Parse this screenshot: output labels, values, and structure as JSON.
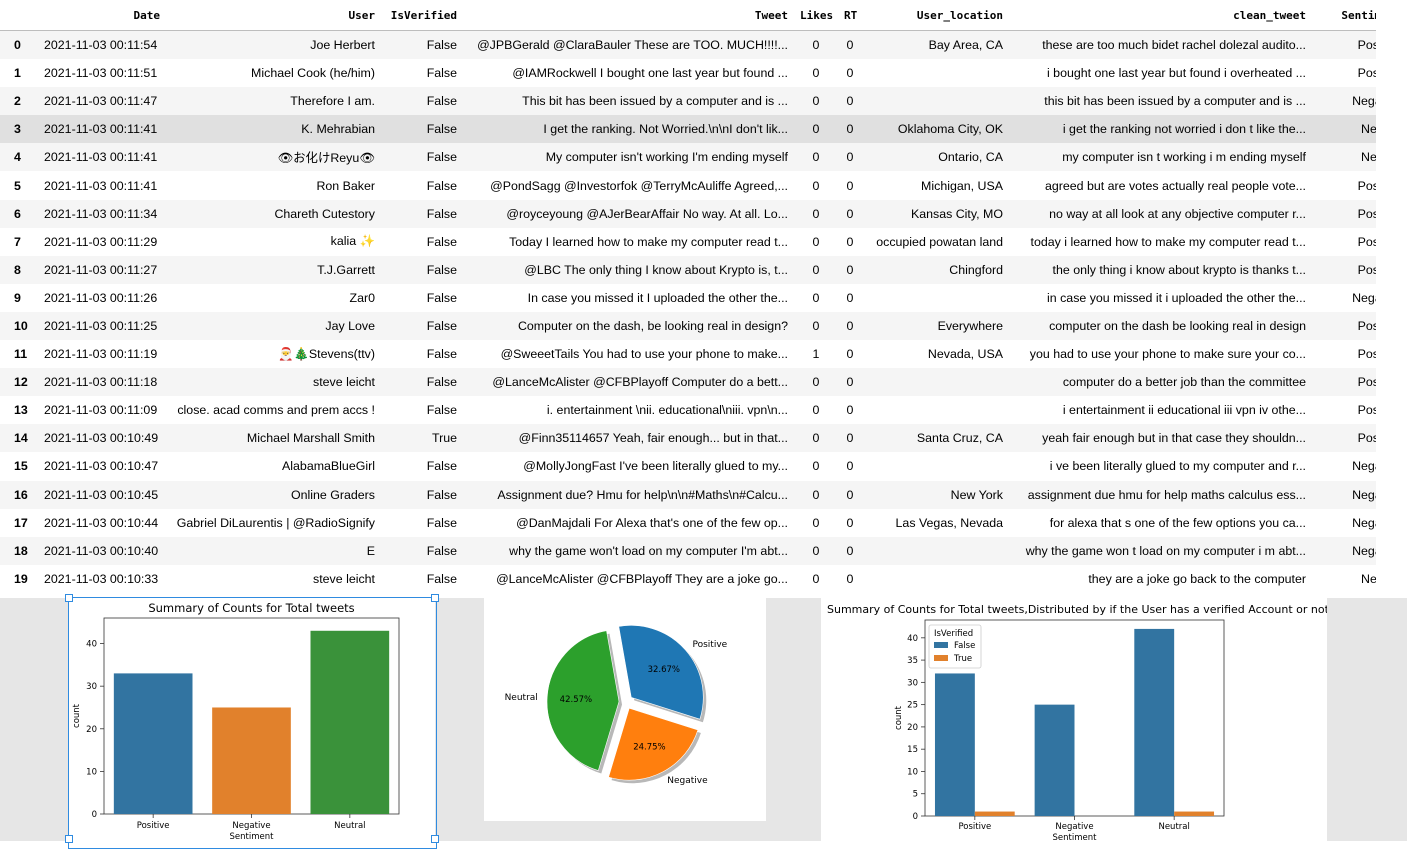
{
  "table": {
    "columns": [
      "",
      "Date",
      "User",
      "IsVerified",
      "Tweet",
      "Likes",
      "RT",
      "User_location",
      "clean_tweet",
      "Sentiment"
    ],
    "highlighted_row": 3,
    "rows": [
      [
        "0",
        "2021-11-03 00:11:54",
        "Joe Herbert",
        "False",
        "@JPBGerald @ClaraBauler These are TOO. MUCH!!!!...",
        "0",
        "0",
        "Bay Area, CA",
        "these are too much bidet rachel dolezal audito...",
        "Positive"
      ],
      [
        "1",
        "2021-11-03 00:11:51",
        "Michael Cook (he/him)",
        "False",
        "@IAMRockwell I bought one last year but found ...",
        "0",
        "0",
        "",
        "i bought one last year but found i overheated ...",
        "Positive"
      ],
      [
        "2",
        "2021-11-03 00:11:47",
        "Therefore I am.",
        "False",
        "This bit has been issued by a computer and is ...",
        "0",
        "0",
        "",
        "this bit has been issued by a computer and is ...",
        "Negative"
      ],
      [
        "3",
        "2021-11-03 00:11:41",
        "K. Mehrabian",
        "False",
        "I get the ranking. Not Worried.\\n\\nI don't lik...",
        "0",
        "0",
        "Oklahoma City, OK",
        "i get the ranking not worried i don t like the...",
        "Neutral"
      ],
      [
        "4",
        "2021-11-03 00:11:41",
        "👁お化けReyu👁",
        "False",
        "My computer isn't working I'm ending myself",
        "0",
        "0",
        "Ontario, CA",
        "my computer isn t working i m ending myself",
        "Neutral"
      ],
      [
        "5",
        "2021-11-03 00:11:41",
        "Ron Baker",
        "False",
        "@PondSagg @Investorfok @TerryMcAuliffe Agreed,...",
        "0",
        "0",
        "Michigan, USA",
        "agreed but are votes actually real people vote...",
        "Positive"
      ],
      [
        "6",
        "2021-11-03 00:11:34",
        "Chareth Cutestory",
        "False",
        "@royceyoung @AJerBearAffair No way. At all. Lo...",
        "0",
        "0",
        "Kansas City, MO",
        "no way at all look at any objective computer r...",
        "Positive"
      ],
      [
        "7",
        "2021-11-03 00:11:29",
        "kalia ✨",
        "False",
        "Today I learned how to make my computer read t...",
        "0",
        "0",
        "occupied powatan land",
        "today i learned how to make my computer read t...",
        "Positive"
      ],
      [
        "8",
        "2021-11-03 00:11:27",
        "T.J.Garrett",
        "False",
        "@LBC The only thing I know about Krypto is, t...",
        "0",
        "0",
        "Chingford",
        "the only thing i know about krypto is thanks t...",
        "Positive"
      ],
      [
        "9",
        "2021-11-03 00:11:26",
        "Zar0",
        "False",
        "In case you missed it I uploaded the other the...",
        "0",
        "0",
        "",
        "in case you missed it i uploaded the other the...",
        "Negative"
      ],
      [
        "10",
        "2021-11-03 00:11:25",
        "Jay Love",
        "False",
        "Computer on the dash, be looking real in design?",
        "0",
        "0",
        "Everywhere",
        "computer on the dash be looking real in design",
        "Positive"
      ],
      [
        "11",
        "2021-11-03 00:11:19",
        "🎅🎄Stevens(ttv)",
        "False",
        "@SweeetTails You had to use your phone to make...",
        "1",
        "0",
        "Nevada, USA",
        "you had to use your phone to make sure your co...",
        "Positive"
      ],
      [
        "12",
        "2021-11-03 00:11:18",
        "steve leicht",
        "False",
        "@LanceMcAlister @CFBPlayoff Computer do a bett...",
        "0",
        "0",
        "",
        "computer do a better job than the committee",
        "Positive"
      ],
      [
        "13",
        "2021-11-03 00:11:09",
        "close. acad comms and prem accs !",
        "False",
        "i. entertainment \\nii. educational\\niii. vpn\\n...",
        "0",
        "0",
        "",
        "i entertainment ii educational iii vpn iv othe...",
        "Positive"
      ],
      [
        "14",
        "2021-11-03 00:10:49",
        "Michael Marshall Smith",
        "True",
        "@Finn35114657 Yeah, fair enough... but in that...",
        "0",
        "0",
        "Santa Cruz, CA",
        "yeah fair enough but in that case they shouldn...",
        "Positive"
      ],
      [
        "15",
        "2021-11-03 00:10:47",
        "AlabamaBlueGirl",
        "False",
        "@MollyJongFast I've been literally glued to my...",
        "0",
        "0",
        "",
        "i ve been literally glued to my computer and r...",
        "Negative"
      ],
      [
        "16",
        "2021-11-03 00:10:45",
        "Online Graders",
        "False",
        "Assignment due? Hmu for help\\n\\n#Maths\\n#Calcu...",
        "0",
        "0",
        "New York",
        "assignment due hmu for help maths calculus ess...",
        "Negative"
      ],
      [
        "17",
        "2021-11-03 00:10:44",
        "Gabriel DiLaurentis | @RadioSignify",
        "False",
        "@DanMajdali For Alexa that's one of the few op...",
        "0",
        "0",
        "Las Vegas, Nevada",
        "for alexa that s one of the few options you ca...",
        "Negative"
      ],
      [
        "18",
        "2021-11-03 00:10:40",
        "E",
        "False",
        "why the game won't load on my computer I'm abt...",
        "0",
        "0",
        "",
        "why the game won t load on my computer i m abt...",
        "Negative"
      ],
      [
        "19",
        "2021-11-03 00:10:33",
        "steve leicht",
        "False",
        "@LanceMcAlister @CFBPlayoff They are a joke go...",
        "0",
        "0",
        "",
        "they are a joke go back to the computer",
        "Neutral"
      ]
    ]
  },
  "chart_data": [
    {
      "type": "bar",
      "title": "Summary of Counts for Total tweets",
      "xlabel": "Sentiment",
      "ylabel": "count",
      "categories": [
        "Positive",
        "Negative",
        "Neutral"
      ],
      "values": [
        33,
        25,
        43
      ],
      "colors": [
        "#3274a1",
        "#e1812c",
        "#3a923a"
      ],
      "ylim": [
        0,
        46
      ],
      "yticks": [
        0,
        10,
        20,
        30,
        40
      ]
    },
    {
      "type": "pie",
      "labels": [
        "Positive",
        "Negative",
        "Neutral"
      ],
      "values": [
        32.67,
        24.75,
        42.57
      ],
      "pct_labels": [
        "32.67%",
        "24.75%",
        "42.57%"
      ],
      "colors": [
        "#1f77b4",
        "#ff7f0e",
        "#2ca02c"
      ]
    },
    {
      "type": "bar",
      "title": "Summary of Counts for Total tweets,Distributed by if the User has a verified Account or not",
      "xlabel": "Sentiment",
      "ylabel": "count",
      "categories": [
        "Positive",
        "Negative",
        "Neutral"
      ],
      "series": [
        {
          "name": "False",
          "values": [
            32,
            25,
            42
          ],
          "color": "#3274a1"
        },
        {
          "name": "True",
          "values": [
            1,
            0,
            1
          ],
          "color": "#e1812c"
        }
      ],
      "legend_title": "IsVerified",
      "legend_position": "top-left",
      "ylim": [
        0,
        44
      ],
      "yticks": [
        0,
        5,
        10,
        15,
        20,
        25,
        30,
        35,
        40
      ]
    }
  ]
}
